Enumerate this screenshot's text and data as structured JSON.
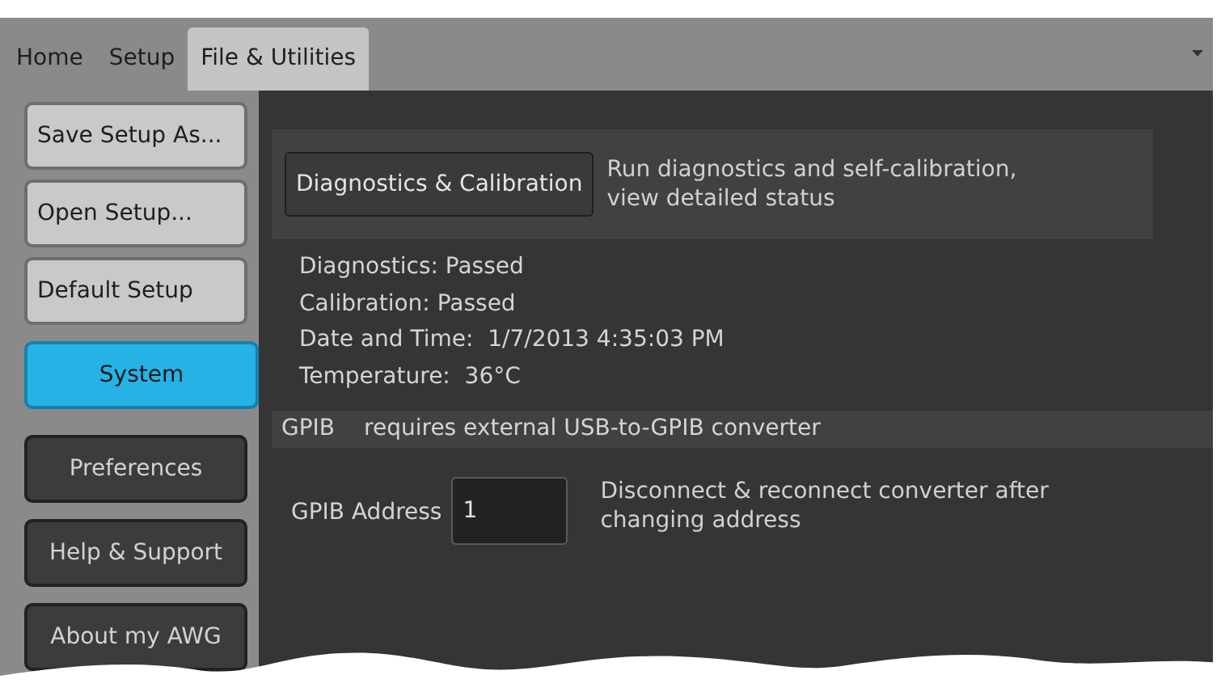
{
  "tabs": [
    {
      "label": "Home",
      "selected": false
    },
    {
      "label": "Setup",
      "selected": false
    },
    {
      "label": "File & Utilities",
      "selected": true
    }
  ],
  "sidebar": {
    "items": [
      {
        "label": "Save Setup As...",
        "kind": "action",
        "selected": false
      },
      {
        "label": "Open Setup...",
        "kind": "action",
        "selected": false
      },
      {
        "label": "Default Setup",
        "kind": "action",
        "selected": false
      },
      {
        "label": "System",
        "kind": "nav",
        "selected": true
      },
      {
        "label": "Preferences",
        "kind": "nav",
        "selected": false
      },
      {
        "label": "Help & Support",
        "kind": "nav",
        "selected": false
      },
      {
        "label": "About my AWG",
        "kind": "nav",
        "selected": false
      }
    ]
  },
  "diagnostics": {
    "button": "Diagnostics & Calibration",
    "description": "Run diagnostics and self-calibration, view detailed status",
    "status": [
      "Diagnostics: Passed",
      "Calibration: Passed",
      "Date and Time:  1/7/2013 4:35:03 PM",
      "Temperature:  36°C"
    ]
  },
  "gpib": {
    "title": "GPIB",
    "note": "requires external USB-to-GPIB converter",
    "address_label": "GPIB Address",
    "address_value": "1",
    "hint": "Disconnect & reconnect converter after changing address"
  }
}
